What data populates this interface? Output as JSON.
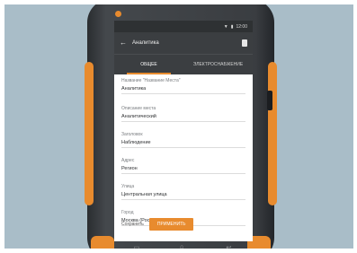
{
  "statusbar": {
    "icons": [
      "signal-icon",
      "battery-icon"
    ],
    "time": "12:00"
  },
  "appbar": {
    "title": "Аналитика",
    "back_icon": "back-arrow-icon",
    "save_icon": "save-icon"
  },
  "tabs": [
    {
      "label": "ОБЩЕЕ",
      "active": true
    },
    {
      "label": "ЭЛЕКТРОСНАБЖЕНИЕ",
      "active": false
    }
  ],
  "form": {
    "header_label": "Название \"Название Места\"",
    "header_value": "Аналитика",
    "fields": [
      {
        "label": "Описание места",
        "value": "Аналитический"
      },
      {
        "label": "Заголовок",
        "value": "Наблюдение"
      },
      {
        "label": "Адрес",
        "value": "Регион"
      },
      {
        "label": "Улица",
        "value": "Центральная улица"
      },
      {
        "label": "Город",
        "value": "Москва (Россия)"
      }
    ]
  },
  "bottom": {
    "left_text": "Сохранить",
    "action_label": "ПРИМЕНИТЬ"
  },
  "colors": {
    "accent": "#e88b2e",
    "toolbar": "#3b3e41",
    "background": "#a9bdc8"
  },
  "navbar": {
    "icons": [
      "recent-apps-icon",
      "home-icon",
      "back-icon"
    ]
  }
}
